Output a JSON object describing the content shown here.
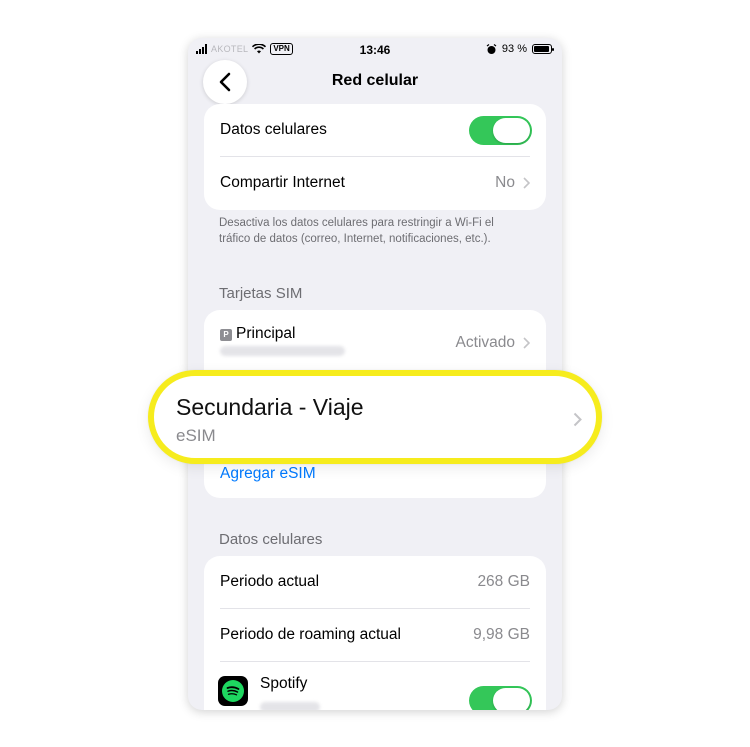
{
  "status_bar": {
    "carrier": "AKOTEL",
    "vpn": "VPN",
    "time": "13:46",
    "battery": "93 %"
  },
  "nav": {
    "title": "Red celular",
    "back": "back"
  },
  "main_card": {
    "datos_celulares_label": "Datos celulares",
    "datos_celulares_on": true,
    "compartir_label": "Compartir Internet",
    "compartir_value": "No"
  },
  "footnote": "Desactiva los datos celulares para restringir a Wi-Fi el tráfico de datos (correo, Internet, notificaciones, etc.).",
  "sim_section": {
    "header": "Tarjetas SIM",
    "principal_badge": "P",
    "principal_label": "Principal",
    "principal_value": "Activado",
    "agregar_esim": "Agregar eSIM"
  },
  "highlight": {
    "title": "Secundaria - Viaje",
    "subtitle": "eSIM"
  },
  "data_section": {
    "header": "Datos celulares",
    "periodo_actual_label": "Periodo actual",
    "periodo_actual_value": "268 GB",
    "roaming_label": "Periodo de roaming actual",
    "roaming_value": "9,98 GB",
    "spotify_label": "Spotify",
    "spotify_on": true
  },
  "colors": {
    "accent_green": "#34c759",
    "link_blue": "#007aff",
    "highlight_yellow": "#f6ec1d",
    "background": "#f0f0f5"
  },
  "icons": [
    "back-chevron-icon",
    "wifi-icon",
    "signal-icon",
    "alarm-icon",
    "battery-icon",
    "chevron-right-icon",
    "spotify-icon"
  ]
}
